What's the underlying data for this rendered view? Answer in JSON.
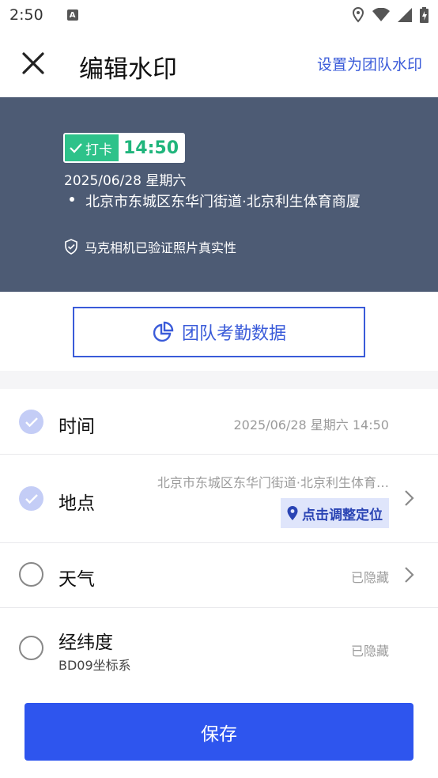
{
  "status_bar": {
    "time": "2:50",
    "notif_letter": "A"
  },
  "header": {
    "title": "编辑水印",
    "team_link": "设置为团队水印"
  },
  "preview": {
    "badge_label": "打卡",
    "badge_time": "14:50",
    "date_line": "2025/06/28  星期六",
    "location": "北京市东城区东华门街道·北京利生体育商厦",
    "verified": "马克相机已验证照片真实性"
  },
  "attendance_button": "团队考勤数据",
  "rows": {
    "time": {
      "label": "时间",
      "value": "2025/06/28 星期六 14:50",
      "checked": true
    },
    "place": {
      "label": "地点",
      "value": "北京市东城区东华门街道·北京利生体育…",
      "action": "点击调整定位",
      "checked": true
    },
    "weather": {
      "label": "天气",
      "value": "已隐藏",
      "checked": false
    },
    "latlng": {
      "label": "经纬度",
      "sub": "BD09坐标系",
      "value": "已隐藏",
      "checked": false
    }
  },
  "save_label": "保存",
  "colors": {
    "accent": "#2e55ee",
    "link": "#3a5bd9",
    "preview_bg": "#4d5b74",
    "badge_green": "#2ec28a"
  }
}
